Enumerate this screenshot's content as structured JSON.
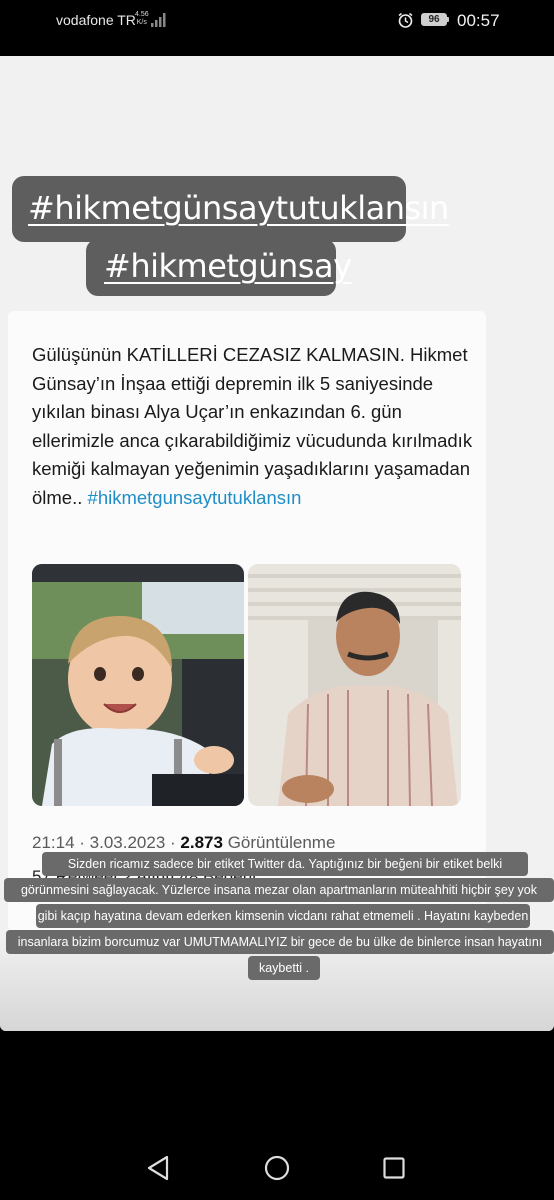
{
  "status_bar": {
    "carrier": "vodafone TR",
    "net_speed_value": "4.56",
    "net_speed_unit": "K/s",
    "battery": "96",
    "time": "00:57"
  },
  "story": {
    "hashtags": [
      "#hikmetgünsaytutuklansın",
      "#hikmetgünsay"
    ],
    "caption_lines": [
      "Sizden ricamız sadece bir etiket Twitter da. Yaptığınız bir beğeni bir etiket belki",
      "görünmesini sağlayacak. Yüzlerce insana mezar olan apartmanların müteahhiti hiçbir şey yok",
      "gibi kaçıp hayatına devam ederken  kimsenin vicdanı rahat etmemeli . Hayatını kaybeden",
      "insanlara bizim borcumuz var UMUTMAMALIYIZ bir gece de bu ülke de binlerce insan hayatını",
      "kaybetti ."
    ]
  },
  "tweet": {
    "body": "Gülüşünün KATİLLERİ CEZASIZ KALMASIN. Hikmet Günsay’ın İnşaa ettiği depremin ilk 5 saniyesinde yıkılan binası Alya Uçar’ın enkazından 6. gün ellerimizle anca çıkarabildiğimiz vücudunda kırılmadık kemiği kalmayan yeğenimin yaşadıklarını yaşamadan ölme..",
    "hashtag": "#hikmetgunsaytutuklansın",
    "time": "21:14 · 3.03.2023 ·",
    "views_count": "2.873",
    "views_label": "Görüntülenme",
    "stats_partial": "57 Retweet   2 Alıntı   48 Beğeni"
  },
  "colors": {
    "hashtag_bubble": "#5e5e5e",
    "tweet_hashtag": "#1f8ec7",
    "caption_bg": "#6a6a6a"
  },
  "icons": {
    "status": [
      "signal-icon",
      "alarm-icon",
      "battery-icon"
    ],
    "nav": [
      "back-triangle-icon",
      "home-circle-icon",
      "recents-square-icon"
    ]
  }
}
